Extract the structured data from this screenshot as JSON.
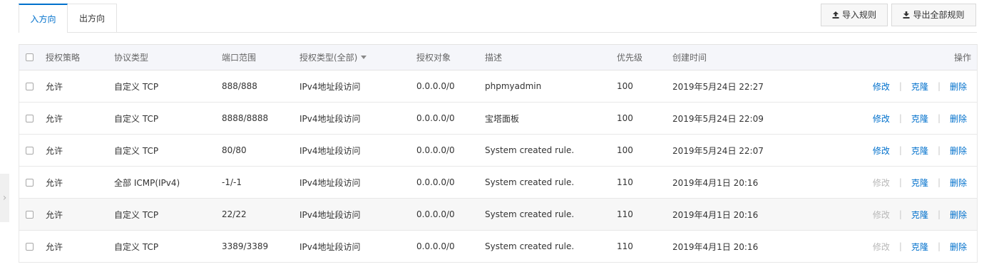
{
  "tabs": [
    {
      "label": "入方向",
      "active": true
    },
    {
      "label": "出方向",
      "active": false
    }
  ],
  "toolbar": {
    "import_label": "导入规则",
    "export_label": "导出全部规则"
  },
  "table": {
    "headers": {
      "policy": "授权策略",
      "protocol": "协议类型",
      "port": "端口范围",
      "auth_type": "授权类型(全部)",
      "target": "授权对象",
      "desc": "描述",
      "priority": "优先级",
      "created": "创建时间",
      "actions": "操作"
    },
    "action_labels": {
      "edit": "修改",
      "clone": "克隆",
      "delete": "删除"
    },
    "rows": [
      {
        "policy": "允许",
        "protocol": "自定义 TCP",
        "port": "888/888",
        "auth_type": "IPv4地址段访问",
        "target": "0.0.0.0/0",
        "desc": "phpmyadmin",
        "priority": "100",
        "created": "2019年5月24日 22:27",
        "edit_enabled": true
      },
      {
        "policy": "允许",
        "protocol": "自定义 TCP",
        "port": "8888/8888",
        "auth_type": "IPv4地址段访问",
        "target": "0.0.0.0/0",
        "desc": "宝塔面板",
        "priority": "100",
        "created": "2019年5月24日 22:09",
        "edit_enabled": true
      },
      {
        "policy": "允许",
        "protocol": "自定义 TCP",
        "port": "80/80",
        "auth_type": "IPv4地址段访问",
        "target": "0.0.0.0/0",
        "desc": "System created rule.",
        "priority": "100",
        "created": "2019年5月24日 22:07",
        "edit_enabled": true
      },
      {
        "policy": "允许",
        "protocol": "全部 ICMP(IPv4)",
        "port": "-1/-1",
        "auth_type": "IPv4地址段访问",
        "target": "0.0.0.0/0",
        "desc": "System created rule.",
        "priority": "110",
        "created": "2019年4月1日 20:16",
        "edit_enabled": false
      },
      {
        "policy": "允许",
        "protocol": "自定义 TCP",
        "port": "22/22",
        "auth_type": "IPv4地址段访问",
        "target": "0.0.0.0/0",
        "desc": "System created rule.",
        "priority": "110",
        "created": "2019年4月1日 20:16",
        "edit_enabled": false
      },
      {
        "policy": "允许",
        "protocol": "自定义 TCP",
        "port": "3389/3389",
        "auth_type": "IPv4地址段访问",
        "target": "0.0.0.0/0",
        "desc": "System created rule.",
        "priority": "110",
        "created": "2019年4月1日 20:16",
        "edit_enabled": false
      }
    ]
  },
  "colors": {
    "accent": "#0070cc",
    "disabled": "#b8b8b8"
  }
}
